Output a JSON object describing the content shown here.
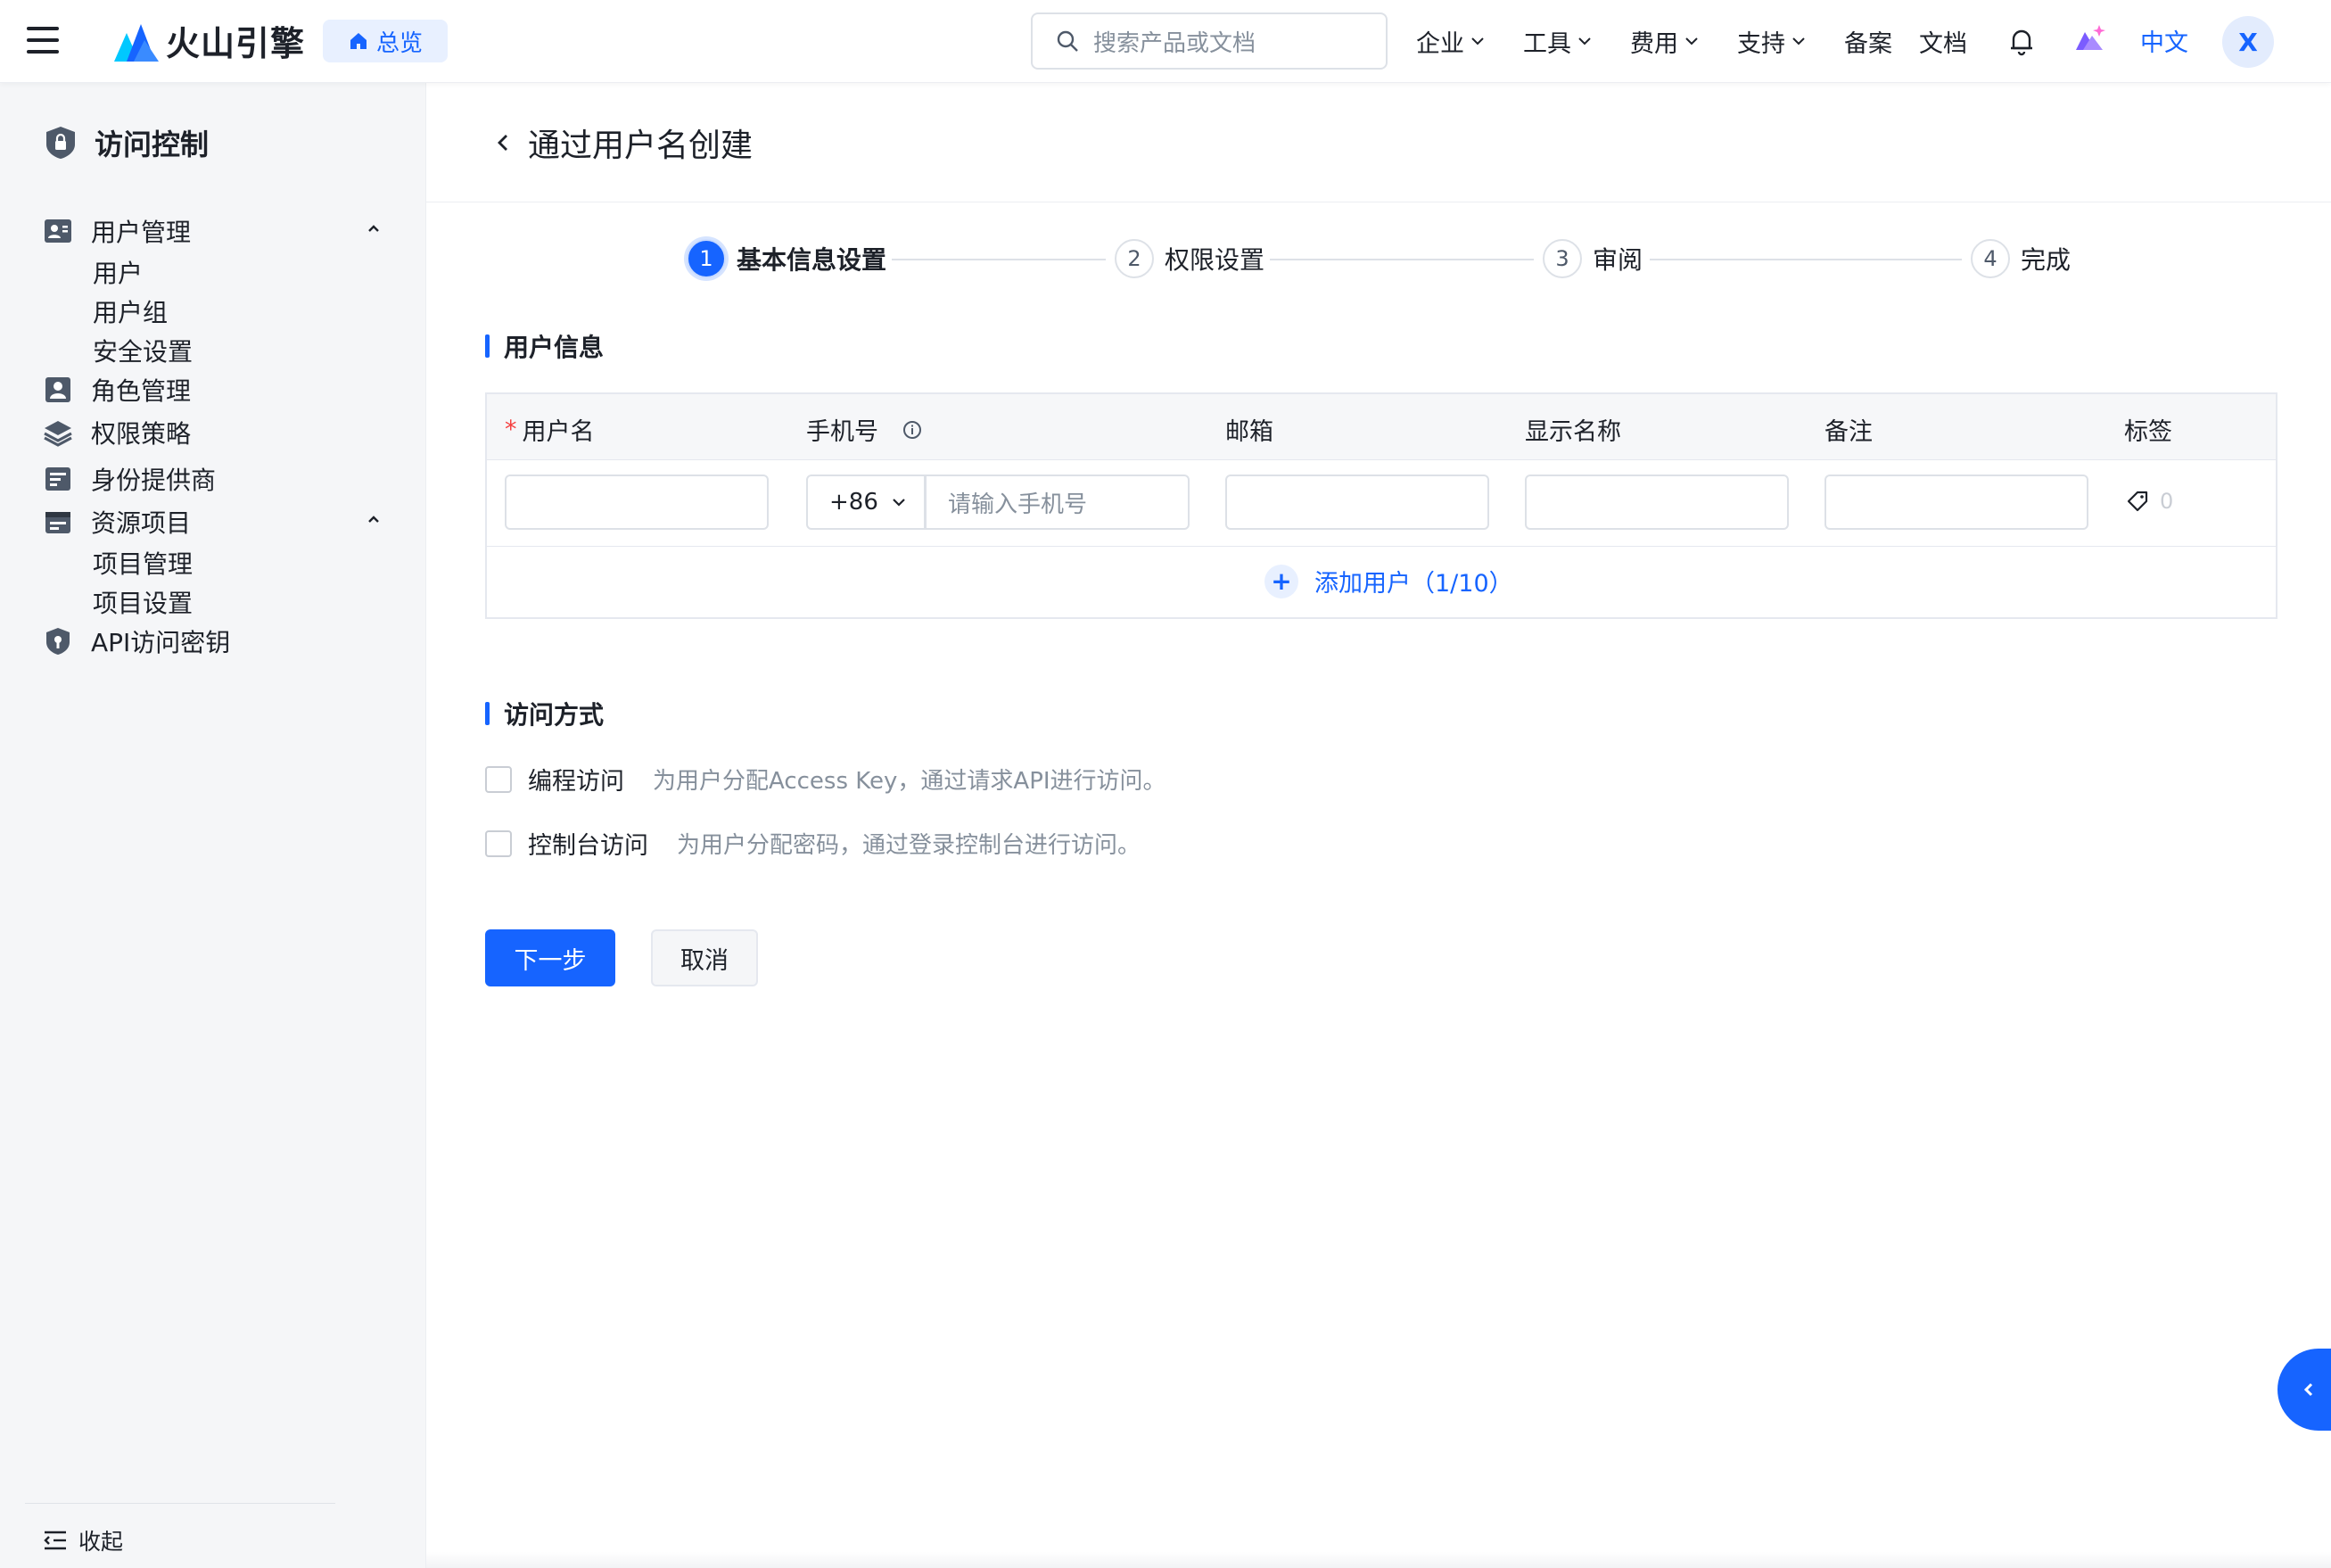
{
  "topbar": {
    "brand": "火山引擎",
    "overview_label": "总览",
    "search_placeholder": "搜索产品或文档",
    "nav": [
      {
        "label": "企业"
      },
      {
        "label": "工具"
      },
      {
        "label": "费用"
      },
      {
        "label": "支持"
      },
      {
        "label": "备案"
      },
      {
        "label": "文档"
      }
    ],
    "language": "中文",
    "avatar_initial": "X"
  },
  "sidebar": {
    "title": "访问控制",
    "groups": [
      {
        "label": "用户管理",
        "icon": "users-icon",
        "children": [
          "用户",
          "用户组",
          "安全设置"
        ]
      },
      {
        "label": "角色管理",
        "icon": "role-icon"
      },
      {
        "label": "权限策略",
        "icon": "layers-icon"
      },
      {
        "label": "身份提供商",
        "icon": "idp-icon"
      },
      {
        "label": "资源项目",
        "icon": "project-icon",
        "children": [
          "项目管理",
          "项目设置"
        ]
      },
      {
        "label": "API访问密钥",
        "icon": "shield-key-icon"
      }
    ],
    "collapse_label": "收起"
  },
  "page": {
    "title": "通过用户名创建"
  },
  "steps": [
    {
      "num": "1",
      "label": "基本信息设置",
      "active": true
    },
    {
      "num": "2",
      "label": "权限设置"
    },
    {
      "num": "3",
      "label": "审阅"
    },
    {
      "num": "4",
      "label": "完成"
    }
  ],
  "user_info": {
    "title": "用户信息",
    "columns": [
      "用户名",
      "手机号",
      "邮箱",
      "显示名称",
      "备注",
      "标签"
    ],
    "phone_prefix": "+86",
    "phone_placeholder": "请输入手机号",
    "tag_count": "0",
    "add_user_label": "添加用户（1/10）"
  },
  "access": {
    "title": "访问方式",
    "options": [
      {
        "label": "编程访问",
        "desc": "为用户分配Access Key，通过请求API进行访问。"
      },
      {
        "label": "控制台访问",
        "desc": "为用户分配密码，通过登录控制台进行访问。"
      }
    ]
  },
  "actions": {
    "next_label": "下一步",
    "cancel_label": "取消"
  },
  "colors": {
    "accent": "#1664ff",
    "required": "#f53f3f"
  }
}
